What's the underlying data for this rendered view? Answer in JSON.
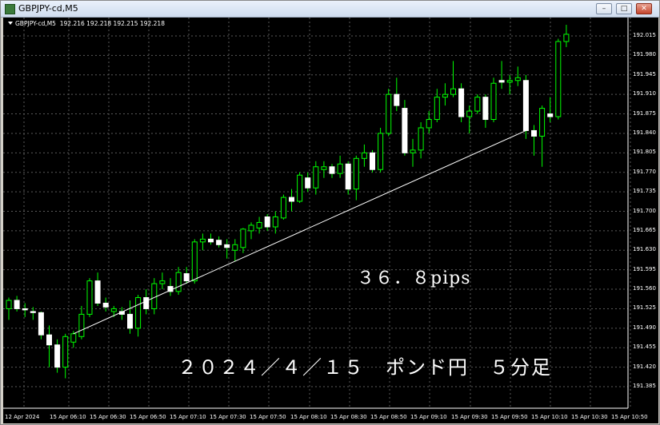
{
  "window": {
    "title": "GBPJPY-cd,M5",
    "minimize_glyph": "–",
    "maximize_glyph": "□",
    "close_glyph": "✕",
    "title_icon": "chart-app-icon"
  },
  "chart_header": {
    "symbol": "GBPJPY-cd,M5",
    "ohlc": "192.216 192.218 192.215 192.218"
  },
  "annotations": {
    "pips": "３６．８pips",
    "caption": "２０２４／４／１５　ポンド円　５分足"
  },
  "colors": {
    "background": "#000000",
    "grid": "#5a5a5a",
    "bull_body": "#000000",
    "bull_outline": "#00ff00",
    "bear_body": "#ffffff",
    "wick": "#00ff00",
    "trendline": "#ffffff",
    "text": "#ffffff"
  },
  "chart_data": {
    "type": "candlestick",
    "grid": true,
    "y_axis_position": "right",
    "ylim": [
      191.385,
      192.035
    ],
    "y_ticks": [
      "192.015",
      "191.980",
      "191.945",
      "191.910",
      "191.875",
      "191.840",
      "191.805",
      "191.770",
      "191.735",
      "191.700",
      "191.665",
      "191.630",
      "191.595",
      "191.560",
      "191.525",
      "191.490",
      "191.455",
      "191.420",
      "191.385"
    ],
    "x_ticks": [
      "12 Apr 2024",
      "15 Apr 06:10",
      "15 Apr 06:30",
      "15 Apr 06:50",
      "15 Apr 07:10",
      "15 Apr 07:30",
      "15 Apr 07:50",
      "15 Apr 08:10",
      "15 Apr 08:30",
      "15 Apr 08:50",
      "15 Apr 09:10",
      "15 Apr 09:30",
      "15 Apr 09:50",
      "15 Apr 10:10",
      "15 Apr 10:30",
      "15 Apr 10:50"
    ],
    "candles": [
      {
        "o": 191.525,
        "h": 191.545,
        "l": 191.505,
        "c": 191.54
      },
      {
        "o": 191.54,
        "h": 191.548,
        "l": 191.52,
        "c": 191.525
      },
      {
        "o": 191.525,
        "h": 191.535,
        "l": 191.51,
        "c": 191.523
      },
      {
        "o": 191.52,
        "h": 191.528,
        "l": 191.505,
        "c": 191.518
      },
      {
        "o": 191.518,
        "h": 191.52,
        "l": 191.47,
        "c": 191.478
      },
      {
        "o": 191.478,
        "h": 191.495,
        "l": 191.42,
        "c": 191.46
      },
      {
        "o": 191.46,
        "h": 191.47,
        "l": 191.41,
        "c": 191.42
      },
      {
        "o": 191.42,
        "h": 191.48,
        "l": 191.4,
        "c": 191.475
      },
      {
        "o": 191.465,
        "h": 191.485,
        "l": 191.455,
        "c": 191.48
      },
      {
        "o": 191.475,
        "h": 191.53,
        "l": 191.47,
        "c": 191.515
      },
      {
        "o": 191.515,
        "h": 191.58,
        "l": 191.51,
        "c": 191.575
      },
      {
        "o": 191.575,
        "h": 191.59,
        "l": 191.53,
        "c": 191.535
      },
      {
        "o": 191.535,
        "h": 191.545,
        "l": 191.52,
        "c": 191.528
      },
      {
        "o": 191.52,
        "h": 191.53,
        "l": 191.51,
        "c": 191.525
      },
      {
        "o": 191.52,
        "h": 191.528,
        "l": 191.505,
        "c": 191.515
      },
      {
        "o": 191.515,
        "h": 191.54,
        "l": 191.48,
        "c": 191.49
      },
      {
        "o": 191.49,
        "h": 191.55,
        "l": 191.475,
        "c": 191.545
      },
      {
        "o": 191.545,
        "h": 191.56,
        "l": 191.515,
        "c": 191.525
      },
      {
        "o": 191.525,
        "h": 191.58,
        "l": 191.515,
        "c": 191.57
      },
      {
        "o": 191.57,
        "h": 191.59,
        "l": 191.56,
        "c": 191.575
      },
      {
        "o": 191.565,
        "h": 191.58,
        "l": 191.548,
        "c": 191.556
      },
      {
        "o": 191.556,
        "h": 191.6,
        "l": 191.55,
        "c": 191.59
      },
      {
        "o": 191.588,
        "h": 191.6,
        "l": 191.57,
        "c": 191.575
      },
      {
        "o": 191.575,
        "h": 191.65,
        "l": 191.57,
        "c": 191.645
      },
      {
        "o": 191.645,
        "h": 191.66,
        "l": 191.63,
        "c": 191.65
      },
      {
        "o": 191.65,
        "h": 191.66,
        "l": 191.64,
        "c": 191.645
      },
      {
        "o": 191.648,
        "h": 191.655,
        "l": 191.635,
        "c": 191.64
      },
      {
        "o": 191.64,
        "h": 191.65,
        "l": 191.615,
        "c": 191.635
      },
      {
        "o": 191.63,
        "h": 191.65,
        "l": 191.61,
        "c": 191.64
      },
      {
        "o": 191.635,
        "h": 191.67,
        "l": 191.625,
        "c": 191.668
      },
      {
        "o": 191.665,
        "h": 191.68,
        "l": 191.65,
        "c": 191.675
      },
      {
        "o": 191.67,
        "h": 191.69,
        "l": 191.66,
        "c": 191.68
      },
      {
        "o": 191.69,
        "h": 191.695,
        "l": 191.665,
        "c": 191.672
      },
      {
        "o": 191.672,
        "h": 191.7,
        "l": 191.66,
        "c": 191.69
      },
      {
        "o": 191.688,
        "h": 191.73,
        "l": 191.685,
        "c": 191.725
      },
      {
        "o": 191.725,
        "h": 191.74,
        "l": 191.7,
        "c": 191.718
      },
      {
        "o": 191.718,
        "h": 191.77,
        "l": 191.715,
        "c": 191.765
      },
      {
        "o": 191.76,
        "h": 191.77,
        "l": 191.735,
        "c": 191.742
      },
      {
        "o": 191.742,
        "h": 191.79,
        "l": 191.73,
        "c": 191.78
      },
      {
        "o": 191.775,
        "h": 191.79,
        "l": 191.76,
        "c": 191.78
      },
      {
        "o": 191.78,
        "h": 191.785,
        "l": 191.76,
        "c": 191.768
      },
      {
        "o": 191.768,
        "h": 191.8,
        "l": 191.76,
        "c": 191.785
      },
      {
        "o": 191.785,
        "h": 191.79,
        "l": 191.73,
        "c": 191.74
      },
      {
        "o": 191.74,
        "h": 191.8,
        "l": 191.72,
        "c": 191.795
      },
      {
        "o": 191.795,
        "h": 191.82,
        "l": 191.78,
        "c": 191.805
      },
      {
        "o": 191.805,
        "h": 191.81,
        "l": 191.77,
        "c": 191.775
      },
      {
        "o": 191.775,
        "h": 191.85,
        "l": 191.77,
        "c": 191.84
      },
      {
        "o": 191.84,
        "h": 191.92,
        "l": 191.835,
        "c": 191.91
      },
      {
        "o": 191.91,
        "h": 191.94,
        "l": 191.88,
        "c": 191.89
      },
      {
        "o": 191.885,
        "h": 191.9,
        "l": 191.8,
        "c": 191.805
      },
      {
        "o": 191.805,
        "h": 191.83,
        "l": 191.78,
        "c": 191.81
      },
      {
        "o": 191.81,
        "h": 191.86,
        "l": 191.795,
        "c": 191.85
      },
      {
        "o": 191.85,
        "h": 191.88,
        "l": 191.84,
        "c": 191.865
      },
      {
        "o": 191.865,
        "h": 191.92,
        "l": 191.86,
        "c": 191.905
      },
      {
        "o": 191.905,
        "h": 191.93,
        "l": 191.89,
        "c": 191.91
      },
      {
        "o": 191.91,
        "h": 191.97,
        "l": 191.905,
        "c": 191.92
      },
      {
        "o": 191.92,
        "h": 191.93,
        "l": 191.86,
        "c": 191.87
      },
      {
        "o": 191.87,
        "h": 191.89,
        "l": 191.84,
        "c": 191.88
      },
      {
        "o": 191.88,
        "h": 191.91,
        "l": 191.875,
        "c": 191.905
      },
      {
        "o": 191.905,
        "h": 191.91,
        "l": 191.85,
        "c": 191.865
      },
      {
        "o": 191.865,
        "h": 191.94,
        "l": 191.86,
        "c": 191.93
      },
      {
        "o": 191.935,
        "h": 191.97,
        "l": 191.92,
        "c": 191.932
      },
      {
        "o": 191.932,
        "h": 191.945,
        "l": 191.91,
        "c": 191.935
      },
      {
        "o": 191.935,
        "h": 191.96,
        "l": 191.925,
        "c": 191.94
      },
      {
        "o": 191.935,
        "h": 191.945,
        "l": 191.83,
        "c": 191.845
      },
      {
        "o": 191.845,
        "h": 191.855,
        "l": 191.8,
        "c": 191.835
      },
      {
        "o": 191.835,
        "h": 191.89,
        "l": 191.78,
        "c": 191.885
      },
      {
        "o": 191.875,
        "h": 191.905,
        "l": 191.86,
        "c": 191.87
      },
      {
        "o": 191.87,
        "h": 192.01,
        "l": 191.865,
        "c": 192.005
      },
      {
        "o": 192.005,
        "h": 192.035,
        "l": 191.995,
        "c": 192.018
      }
    ],
    "trendline": {
      "from": {
        "index": 8,
        "price": 191.48
      },
      "to": {
        "index": 64,
        "price": 191.845
      }
    }
  }
}
